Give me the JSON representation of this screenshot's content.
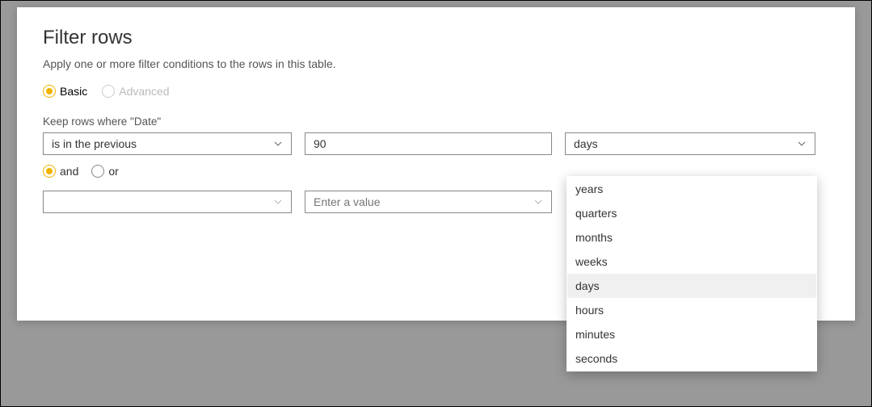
{
  "dialog": {
    "title": "Filter rows",
    "subtitle": "Apply one or more filter conditions to the rows in this table."
  },
  "tabs": {
    "basic": "Basic",
    "advanced": "Advanced"
  },
  "keep_label": "Keep rows where \"Date\"",
  "row1": {
    "operator": "is in the previous",
    "value": "90",
    "unit": "days"
  },
  "joiner": {
    "and": "and",
    "or": "or"
  },
  "row2": {
    "operator": "",
    "placeholder": "Enter a value"
  },
  "units_dropdown": {
    "options": {
      "0": "years",
      "1": "quarters",
      "2": "months",
      "3": "weeks",
      "4": "days",
      "5": "hours",
      "6": "minutes",
      "7": "seconds"
    },
    "selected_index": 4
  }
}
